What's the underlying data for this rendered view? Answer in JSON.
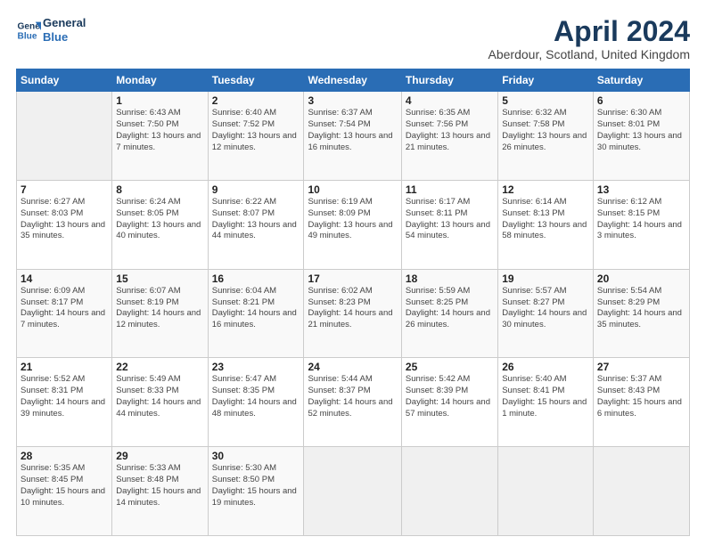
{
  "header": {
    "logo_line1": "General",
    "logo_line2": "Blue",
    "month_title": "April 2024",
    "location": "Aberdour, Scotland, United Kingdom"
  },
  "weekdays": [
    "Sunday",
    "Monday",
    "Tuesday",
    "Wednesday",
    "Thursday",
    "Friday",
    "Saturday"
  ],
  "weeks": [
    [
      {
        "day": "",
        "sunrise": "",
        "sunset": "",
        "daylight": ""
      },
      {
        "day": "1",
        "sunrise": "Sunrise: 6:43 AM",
        "sunset": "Sunset: 7:50 PM",
        "daylight": "Daylight: 13 hours and 7 minutes."
      },
      {
        "day": "2",
        "sunrise": "Sunrise: 6:40 AM",
        "sunset": "Sunset: 7:52 PM",
        "daylight": "Daylight: 13 hours and 12 minutes."
      },
      {
        "day": "3",
        "sunrise": "Sunrise: 6:37 AM",
        "sunset": "Sunset: 7:54 PM",
        "daylight": "Daylight: 13 hours and 16 minutes."
      },
      {
        "day": "4",
        "sunrise": "Sunrise: 6:35 AM",
        "sunset": "Sunset: 7:56 PM",
        "daylight": "Daylight: 13 hours and 21 minutes."
      },
      {
        "day": "5",
        "sunrise": "Sunrise: 6:32 AM",
        "sunset": "Sunset: 7:58 PM",
        "daylight": "Daylight: 13 hours and 26 minutes."
      },
      {
        "day": "6",
        "sunrise": "Sunrise: 6:30 AM",
        "sunset": "Sunset: 8:01 PM",
        "daylight": "Daylight: 13 hours and 30 minutes."
      }
    ],
    [
      {
        "day": "7",
        "sunrise": "Sunrise: 6:27 AM",
        "sunset": "Sunset: 8:03 PM",
        "daylight": "Daylight: 13 hours and 35 minutes."
      },
      {
        "day": "8",
        "sunrise": "Sunrise: 6:24 AM",
        "sunset": "Sunset: 8:05 PM",
        "daylight": "Daylight: 13 hours and 40 minutes."
      },
      {
        "day": "9",
        "sunrise": "Sunrise: 6:22 AM",
        "sunset": "Sunset: 8:07 PM",
        "daylight": "Daylight: 13 hours and 44 minutes."
      },
      {
        "day": "10",
        "sunrise": "Sunrise: 6:19 AM",
        "sunset": "Sunset: 8:09 PM",
        "daylight": "Daylight: 13 hours and 49 minutes."
      },
      {
        "day": "11",
        "sunrise": "Sunrise: 6:17 AM",
        "sunset": "Sunset: 8:11 PM",
        "daylight": "Daylight: 13 hours and 54 minutes."
      },
      {
        "day": "12",
        "sunrise": "Sunrise: 6:14 AM",
        "sunset": "Sunset: 8:13 PM",
        "daylight": "Daylight: 13 hours and 58 minutes."
      },
      {
        "day": "13",
        "sunrise": "Sunrise: 6:12 AM",
        "sunset": "Sunset: 8:15 PM",
        "daylight": "Daylight: 14 hours and 3 minutes."
      }
    ],
    [
      {
        "day": "14",
        "sunrise": "Sunrise: 6:09 AM",
        "sunset": "Sunset: 8:17 PM",
        "daylight": "Daylight: 14 hours and 7 minutes."
      },
      {
        "day": "15",
        "sunrise": "Sunrise: 6:07 AM",
        "sunset": "Sunset: 8:19 PM",
        "daylight": "Daylight: 14 hours and 12 minutes."
      },
      {
        "day": "16",
        "sunrise": "Sunrise: 6:04 AM",
        "sunset": "Sunset: 8:21 PM",
        "daylight": "Daylight: 14 hours and 16 minutes."
      },
      {
        "day": "17",
        "sunrise": "Sunrise: 6:02 AM",
        "sunset": "Sunset: 8:23 PM",
        "daylight": "Daylight: 14 hours and 21 minutes."
      },
      {
        "day": "18",
        "sunrise": "Sunrise: 5:59 AM",
        "sunset": "Sunset: 8:25 PM",
        "daylight": "Daylight: 14 hours and 26 minutes."
      },
      {
        "day": "19",
        "sunrise": "Sunrise: 5:57 AM",
        "sunset": "Sunset: 8:27 PM",
        "daylight": "Daylight: 14 hours and 30 minutes."
      },
      {
        "day": "20",
        "sunrise": "Sunrise: 5:54 AM",
        "sunset": "Sunset: 8:29 PM",
        "daylight": "Daylight: 14 hours and 35 minutes."
      }
    ],
    [
      {
        "day": "21",
        "sunrise": "Sunrise: 5:52 AM",
        "sunset": "Sunset: 8:31 PM",
        "daylight": "Daylight: 14 hours and 39 minutes."
      },
      {
        "day": "22",
        "sunrise": "Sunrise: 5:49 AM",
        "sunset": "Sunset: 8:33 PM",
        "daylight": "Daylight: 14 hours and 44 minutes."
      },
      {
        "day": "23",
        "sunrise": "Sunrise: 5:47 AM",
        "sunset": "Sunset: 8:35 PM",
        "daylight": "Daylight: 14 hours and 48 minutes."
      },
      {
        "day": "24",
        "sunrise": "Sunrise: 5:44 AM",
        "sunset": "Sunset: 8:37 PM",
        "daylight": "Daylight: 14 hours and 52 minutes."
      },
      {
        "day": "25",
        "sunrise": "Sunrise: 5:42 AM",
        "sunset": "Sunset: 8:39 PM",
        "daylight": "Daylight: 14 hours and 57 minutes."
      },
      {
        "day": "26",
        "sunrise": "Sunrise: 5:40 AM",
        "sunset": "Sunset: 8:41 PM",
        "daylight": "Daylight: 15 hours and 1 minute."
      },
      {
        "day": "27",
        "sunrise": "Sunrise: 5:37 AM",
        "sunset": "Sunset: 8:43 PM",
        "daylight": "Daylight: 15 hours and 6 minutes."
      }
    ],
    [
      {
        "day": "28",
        "sunrise": "Sunrise: 5:35 AM",
        "sunset": "Sunset: 8:45 PM",
        "daylight": "Daylight: 15 hours and 10 minutes."
      },
      {
        "day": "29",
        "sunrise": "Sunrise: 5:33 AM",
        "sunset": "Sunset: 8:48 PM",
        "daylight": "Daylight: 15 hours and 14 minutes."
      },
      {
        "day": "30",
        "sunrise": "Sunrise: 5:30 AM",
        "sunset": "Sunset: 8:50 PM",
        "daylight": "Daylight: 15 hours and 19 minutes."
      },
      {
        "day": "",
        "sunrise": "",
        "sunset": "",
        "daylight": ""
      },
      {
        "day": "",
        "sunrise": "",
        "sunset": "",
        "daylight": ""
      },
      {
        "day": "",
        "sunrise": "",
        "sunset": "",
        "daylight": ""
      },
      {
        "day": "",
        "sunrise": "",
        "sunset": "",
        "daylight": ""
      }
    ]
  ]
}
